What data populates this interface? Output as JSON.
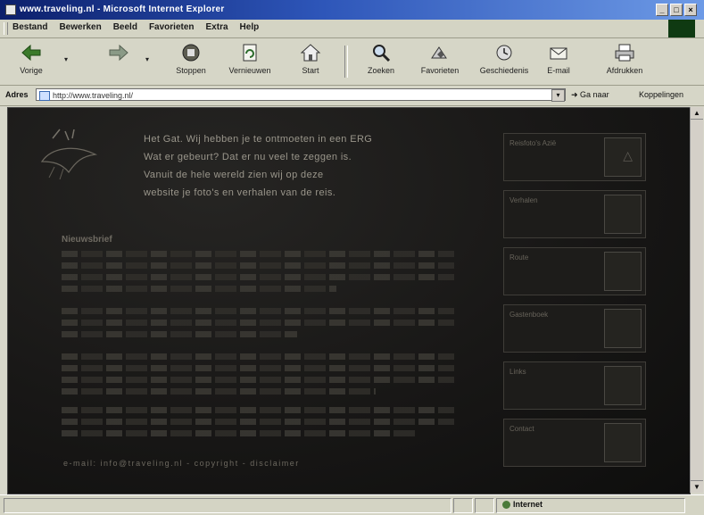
{
  "window": {
    "title": "www.traveling.nl - Microsoft Internet Explorer",
    "buttons": {
      "minimize": "_",
      "maximize": "□",
      "close": "×"
    }
  },
  "menu": {
    "items": [
      "Bestand",
      "Bewerken",
      "Beeld",
      "Favorieten",
      "Extra",
      "Help"
    ]
  },
  "toolbar": {
    "buttons": [
      {
        "label": "Vorige",
        "icon": "back-arrow-icon"
      },
      {
        "label": "",
        "icon": "forward-arrow-icon"
      },
      {
        "label": "Stoppen",
        "icon": "stop-icon"
      },
      {
        "label": "Vernieuwen",
        "icon": "refresh-icon"
      },
      {
        "label": "Start",
        "icon": "home-icon"
      },
      {
        "label": "Zoeken",
        "icon": "search-icon"
      },
      {
        "label": "Favorieten",
        "icon": "favorites-icon"
      },
      {
        "label": "Geschiedenis",
        "icon": "history-icon"
      },
      {
        "label": "E-mail",
        "icon": "mail-icon"
      },
      {
        "label": "Afdrukken",
        "icon": "print-icon"
      }
    ]
  },
  "address": {
    "label": "Adres",
    "url": "http://www.traveling.nl/",
    "go_label": "Ga naar",
    "links_label": "Koppelingen"
  },
  "page": {
    "intro_lines": [
      "Het Gat. Wij hebben je te ontmoeten in een ERG",
      "Wat er gebeurt? Dat er nu veel te zeggen is.",
      "Vanuit de hele wereld zien wij op deze",
      "website je foto's en verhalen van de reis."
    ],
    "section_title": "Nieuwsbrief",
    "bottom_line": "e-mail: info@traveling.nl - copyright - disclaimer",
    "side_items": [
      {
        "title": "Reisfoto's Azië"
      },
      {
        "title": "Verhalen"
      },
      {
        "title": "Route"
      },
      {
        "title": "Gastenboek"
      },
      {
        "title": "Links"
      },
      {
        "title": "Contact"
      }
    ]
  },
  "status": {
    "zone": "Internet"
  },
  "colors": {
    "titlebar_start": "#0c1f6b",
    "titlebar_end": "#6d9ae6",
    "chrome": "#d6d6c7",
    "page_background": "#181716"
  }
}
